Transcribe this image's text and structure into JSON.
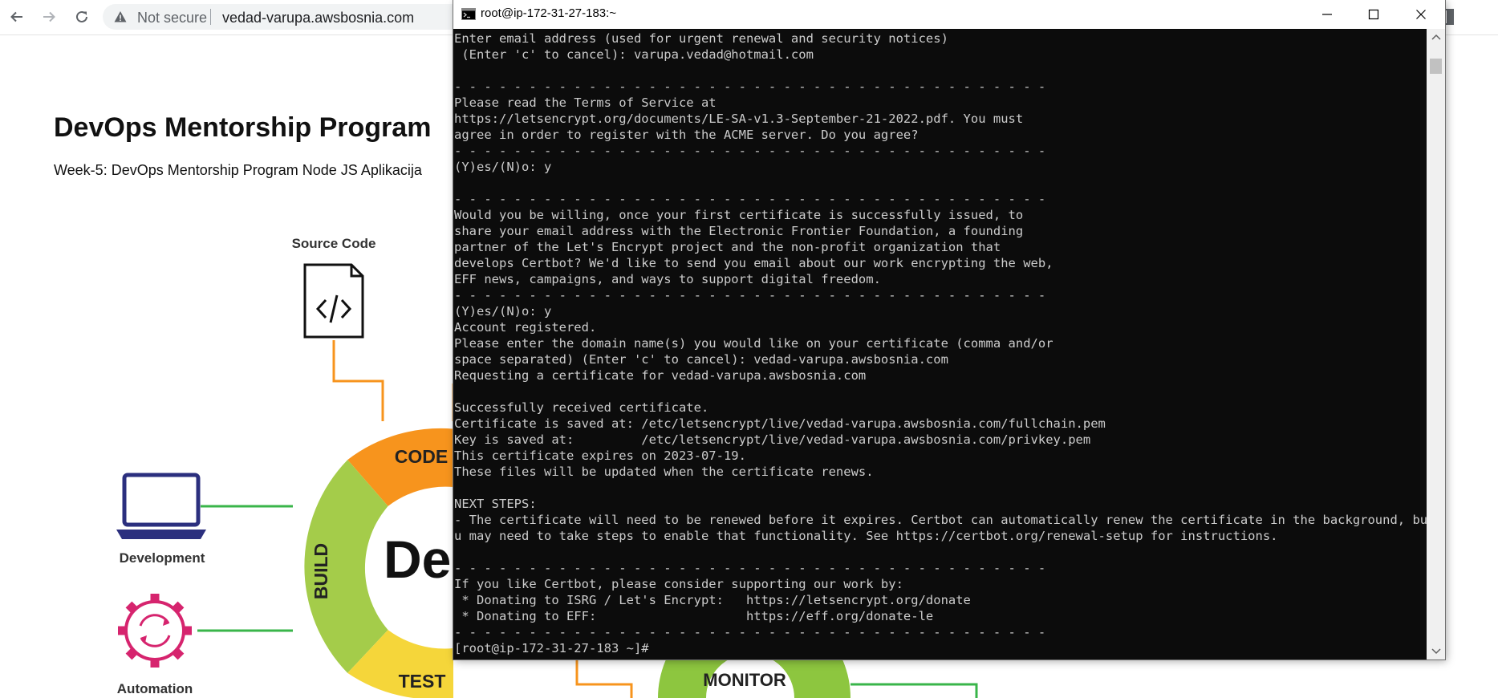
{
  "browser": {
    "security_label": "Not secure",
    "url": "vedad-varupa.awsbosnia.com"
  },
  "page": {
    "title": "DevOps Mentorship Program",
    "subtitle": "Week-5: DevOps Mentorship Program Node JS Aplikacija",
    "diagram": {
      "source_code_label": "Source Code",
      "development_label": "Development",
      "automation_label": "Automation",
      "ring_code": "CODE",
      "ring_build": "BUILD",
      "ring_test": "TEST",
      "ring_monitor": "MONITOR",
      "center_text": "De",
      "colors": {
        "orange": "#f7941d",
        "green": "#8dc63f",
        "yellow": "#f5d63a",
        "navy": "#2b2f7e",
        "magenta": "#d6246e",
        "line_green": "#39b54a"
      }
    }
  },
  "terminal": {
    "title": "root@ip-172-31-27-183:~",
    "lines": [
      "Enter email address (used for urgent renewal and security notices)",
      " (Enter 'c' to cancel): varupa.vedad@hotmail.com",
      "",
      "- - - - - - - - - - - - - - - - - - - - - - - - - - - - - - - - - - - - - - - -",
      "Please read the Terms of Service at",
      "https://letsencrypt.org/documents/LE-SA-v1.3-September-21-2022.pdf. You must",
      "agree in order to register with the ACME server. Do you agree?",
      "- - - - - - - - - - - - - - - - - - - - - - - - - - - - - - - - - - - - - - - -",
      "(Y)es/(N)o: y",
      "",
      "- - - - - - - - - - - - - - - - - - - - - - - - - - - - - - - - - - - - - - - -",
      "Would you be willing, once your first certificate is successfully issued, to",
      "share your email address with the Electronic Frontier Foundation, a founding",
      "partner of the Let's Encrypt project and the non-profit organization that",
      "develops Certbot? We'd like to send you email about our work encrypting the web,",
      "EFF news, campaigns, and ways to support digital freedom.",
      "- - - - - - - - - - - - - - - - - - - - - - - - - - - - - - - - - - - - - - - -",
      "(Y)es/(N)o: y",
      "Account registered.",
      "Please enter the domain name(s) you would like on your certificate (comma and/or",
      "space separated) (Enter 'c' to cancel): vedad-varupa.awsbosnia.com",
      "Requesting a certificate for vedad-varupa.awsbosnia.com",
      "",
      "Successfully received certificate.",
      "Certificate is saved at: /etc/letsencrypt/live/vedad-varupa.awsbosnia.com/fullchain.pem",
      "Key is saved at:         /etc/letsencrypt/live/vedad-varupa.awsbosnia.com/privkey.pem",
      "This certificate expires on 2023-07-19.",
      "These files will be updated when the certificate renews.",
      "",
      "NEXT STEPS:",
      "- The certificate will need to be renewed before it expires. Certbot can automatically renew the certificate in the background, but yo",
      "u may need to take steps to enable that functionality. See https://certbot.org/renewal-setup for instructions.",
      "",
      "- - - - - - - - - - - - - - - - - - - - - - - - - - - - - - - - - - - - - - - -",
      "If you like Certbot, please consider supporting our work by:",
      " * Donating to ISRG / Let's Encrypt:   https://letsencrypt.org/donate",
      " * Donating to EFF:                    https://eff.org/donate-le",
      "- - - - - - - - - - - - - - - - - - - - - - - - - - - - - - - - - - - - - - - -",
      "[root@ip-172-31-27-183 ~]# "
    ]
  }
}
